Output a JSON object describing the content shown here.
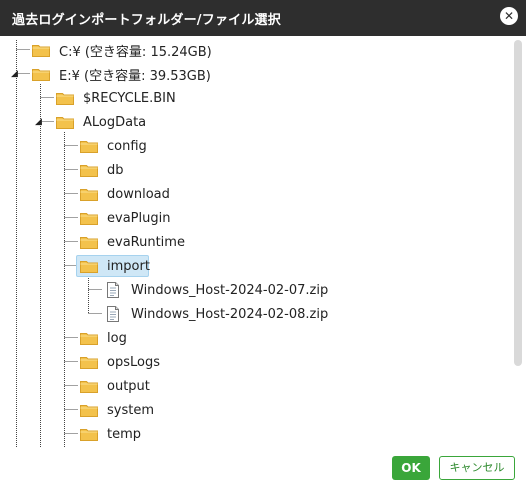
{
  "dialog": {
    "title": "過去ログインポートフォルダー/ファイル選択",
    "close_icon": "close-icon"
  },
  "tree": {
    "drive_c": "C:¥ (空き容量: 15.24GB)",
    "drive_e": "E:¥ (空き容量: 39.53GB)",
    "recycle_bin": "$RECYCLE.BIN",
    "alogdata": "ALogData",
    "config": "config",
    "db": "db",
    "download": "download",
    "evaplugin": "evaPlugin",
    "evaruntime": "evaRuntime",
    "import": "import",
    "file_1": "Windows_Host-2024-02-07.zip",
    "file_2": "Windows_Host-2024-02-08.zip",
    "log": "log",
    "opslogs": "opsLogs",
    "output": "output",
    "system": "system",
    "temp": "temp",
    "selected": "import"
  },
  "buttons": {
    "ok": "OK",
    "cancel": "キャンセル"
  },
  "colors": {
    "titlebar": "#2e2e2e",
    "ok_green": "#3aa63a",
    "selection": "#cfe7f6",
    "folder": "#f3c24c"
  }
}
